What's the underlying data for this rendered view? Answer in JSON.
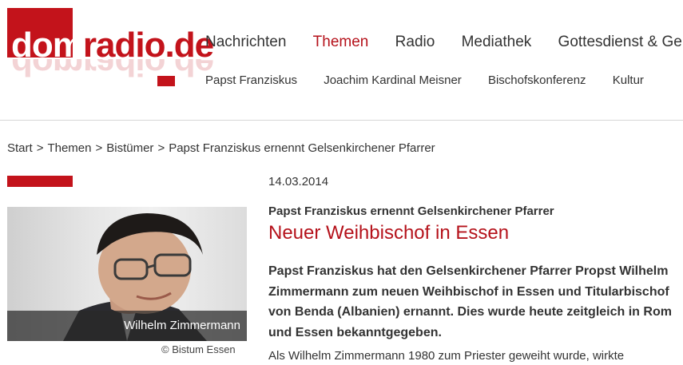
{
  "brand": {
    "logo_prefix": "dom",
    "logo_suffix": "radio.de",
    "accent_color": "#c3131b",
    "title_color": "#b5121b"
  },
  "nav": {
    "main": [
      "Nachrichten",
      "Themen",
      "Radio",
      "Mediathek",
      "Gottesdienst & Geb"
    ],
    "active": "Themen",
    "sub": [
      "Papst Franziskus",
      "Joachim Kardinal Meisner",
      "Bischofskonferenz",
      "Kultur"
    ]
  },
  "breadcrumb": {
    "items": [
      "Start",
      "Themen",
      "Bistümer",
      "Papst Franziskus ernennt Gelsenkirchener Pfarrer"
    ],
    "separator": ">"
  },
  "photo": {
    "caption": "Wilhelm Zimmermann",
    "copyright": "© Bistum Essen"
  },
  "article": {
    "date": "14.03.2014",
    "kicker": "Papst Franziskus ernennt Gelsenkirchener Pfarrer",
    "title": "Neuer Weihbischof in Essen",
    "lead_lines": [
      "Papst Franziskus hat den Gelsenkirchener Pfarrer Propst Wilhelm",
      "Zimmermann zum neuen Weihbischof in Essen und Titularbischof",
      "von Benda (Albanien) ernannt. Dies wurde heute zeitgleich in Rom",
      "und Essen bekanntgegeben."
    ],
    "body_partial": "Als Wilhelm Zimmermann 1980 zum Priester geweiht wurde, wirkte"
  }
}
